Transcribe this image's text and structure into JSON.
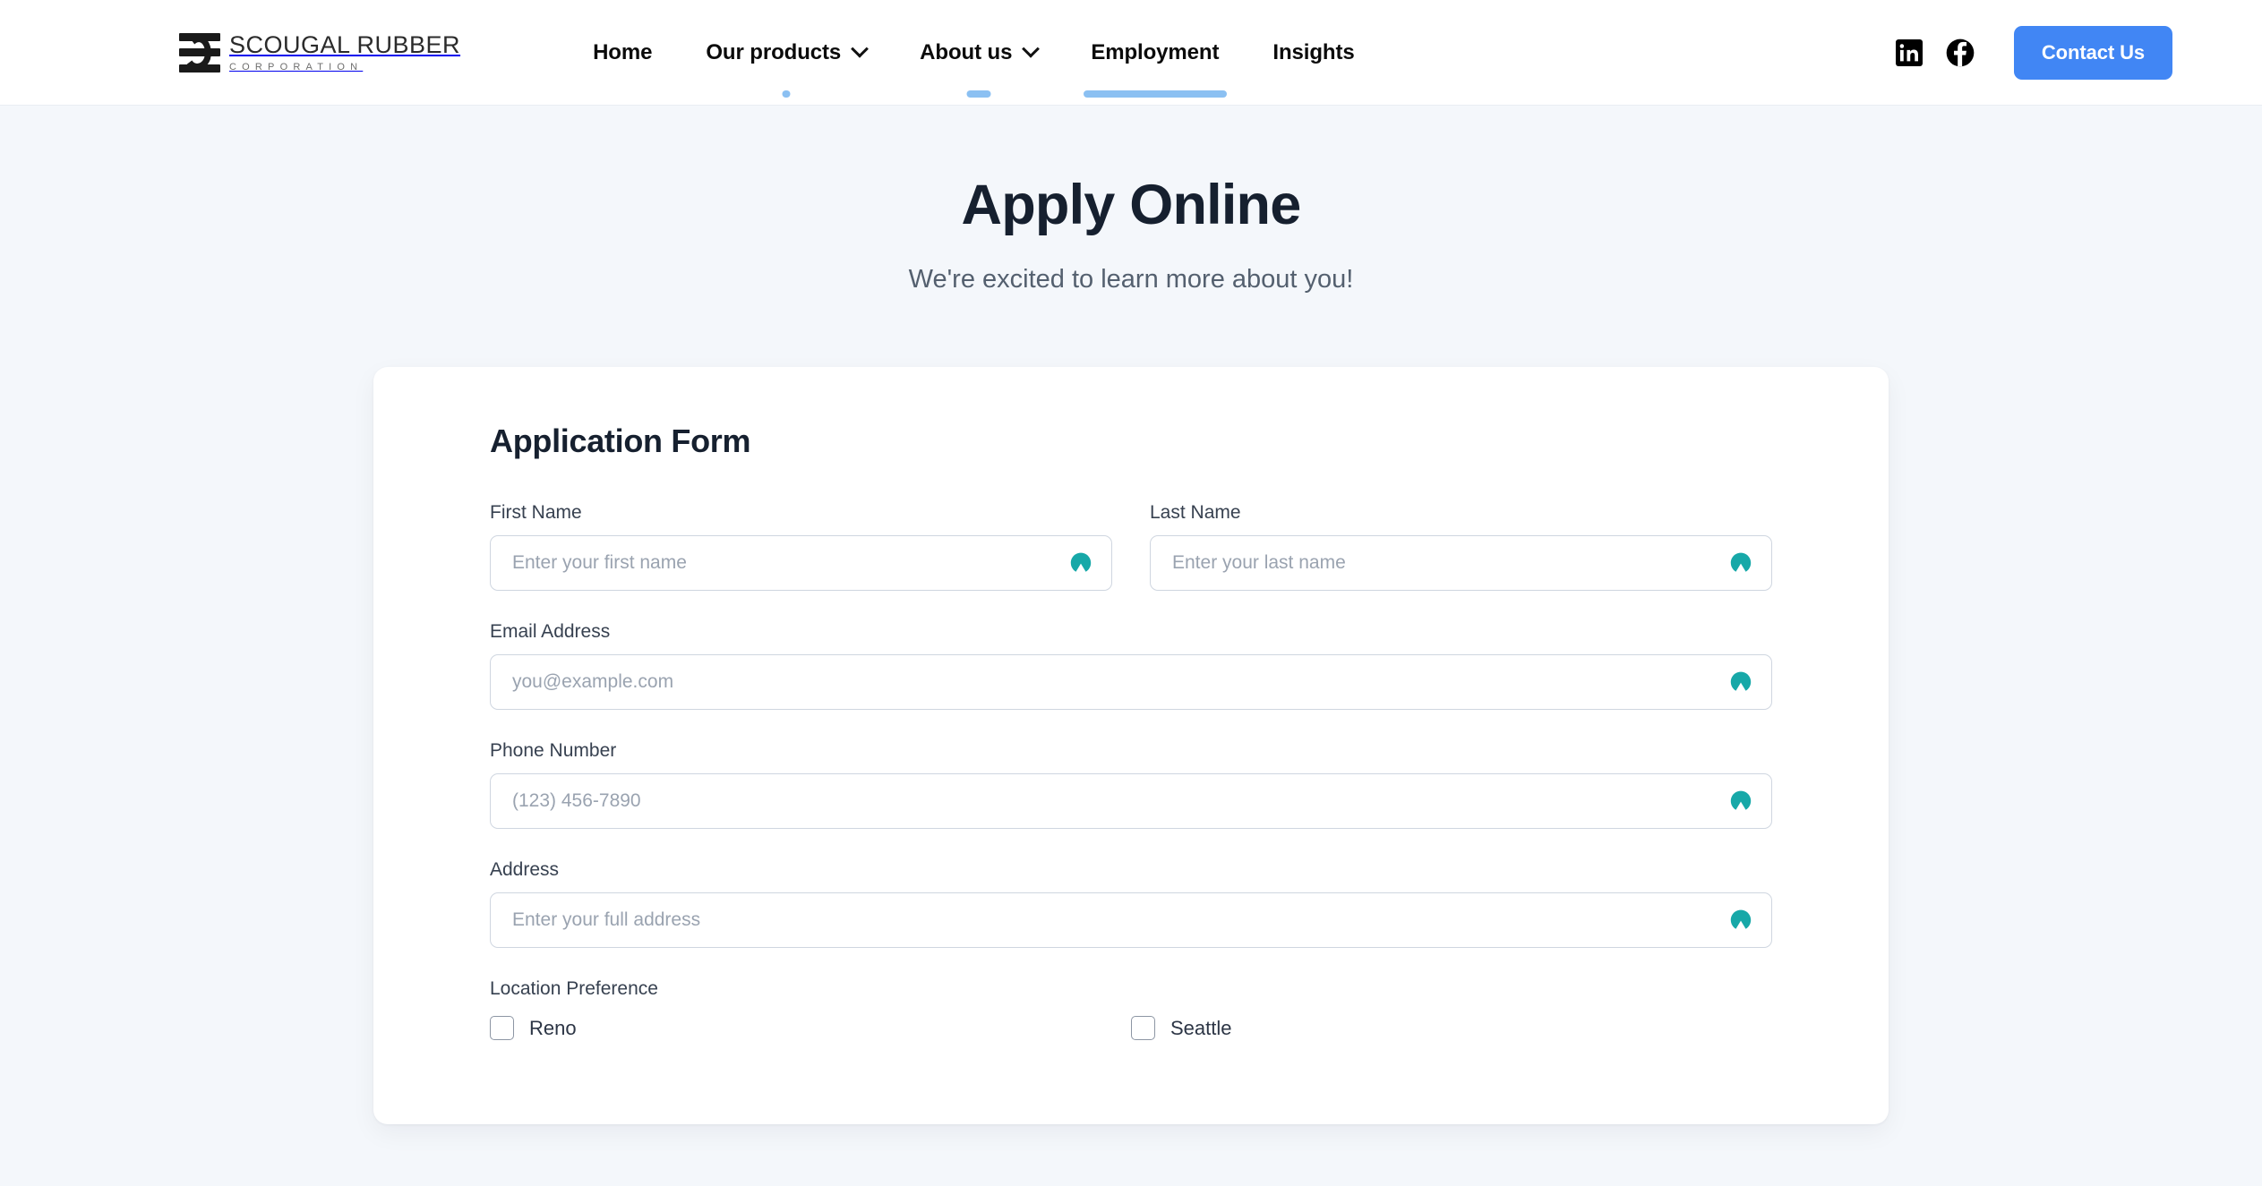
{
  "header": {
    "logo": {
      "title": "SCOUGAL RUBBER",
      "subtitle": "CORPORATION"
    },
    "nav_items": [
      {
        "label": "Home",
        "has_caret": false,
        "indicator": "none"
      },
      {
        "label": "Our products",
        "has_caret": true,
        "indicator": "dot"
      },
      {
        "label": "About us",
        "has_caret": true,
        "indicator": "sm"
      },
      {
        "label": "Employment",
        "has_caret": false,
        "indicator": "full"
      },
      {
        "label": "Insights",
        "has_caret": false,
        "indicator": "none"
      }
    ],
    "social": [
      {
        "name": "linkedin",
        "label": "LinkedIn"
      },
      {
        "name": "facebook",
        "label": "Facebook"
      }
    ],
    "contact_button": "Contact Us"
  },
  "hero": {
    "title": "Apply Online",
    "subtitle": "We're excited to learn more about you!"
  },
  "form": {
    "heading": "Application Form",
    "fields": {
      "first_name": {
        "label": "First Name",
        "placeholder": "Enter your first name",
        "value": ""
      },
      "last_name": {
        "label": "Last Name",
        "placeholder": "Enter your last name",
        "value": ""
      },
      "email": {
        "label": "Email Address",
        "placeholder": "you@example.com",
        "value": ""
      },
      "phone": {
        "label": "Phone Number",
        "placeholder": "(123) 456-7890",
        "value": ""
      },
      "address": {
        "label": "Address",
        "placeholder": "Enter your full address",
        "value": ""
      }
    },
    "location_preference": {
      "label": "Location Preference",
      "options": [
        {
          "label": "Reno",
          "checked": false
        },
        {
          "label": "Seattle",
          "checked": false
        }
      ]
    }
  },
  "colors": {
    "accent_blue": "#4186f4",
    "underline_blue": "#8bc0f2",
    "page_bg": "#f4f7fb",
    "card_bg": "#ffffff",
    "heading": "#16202f",
    "subtitle": "#54606f",
    "label": "#374150",
    "placeholder": "#9aa3b0",
    "input_border": "#cfd6e0",
    "password_badge_teal": "#17a8a8"
  },
  "icons": {
    "caret": "chevron-down-icon",
    "password_badge": "nordpass-badge-icon"
  }
}
